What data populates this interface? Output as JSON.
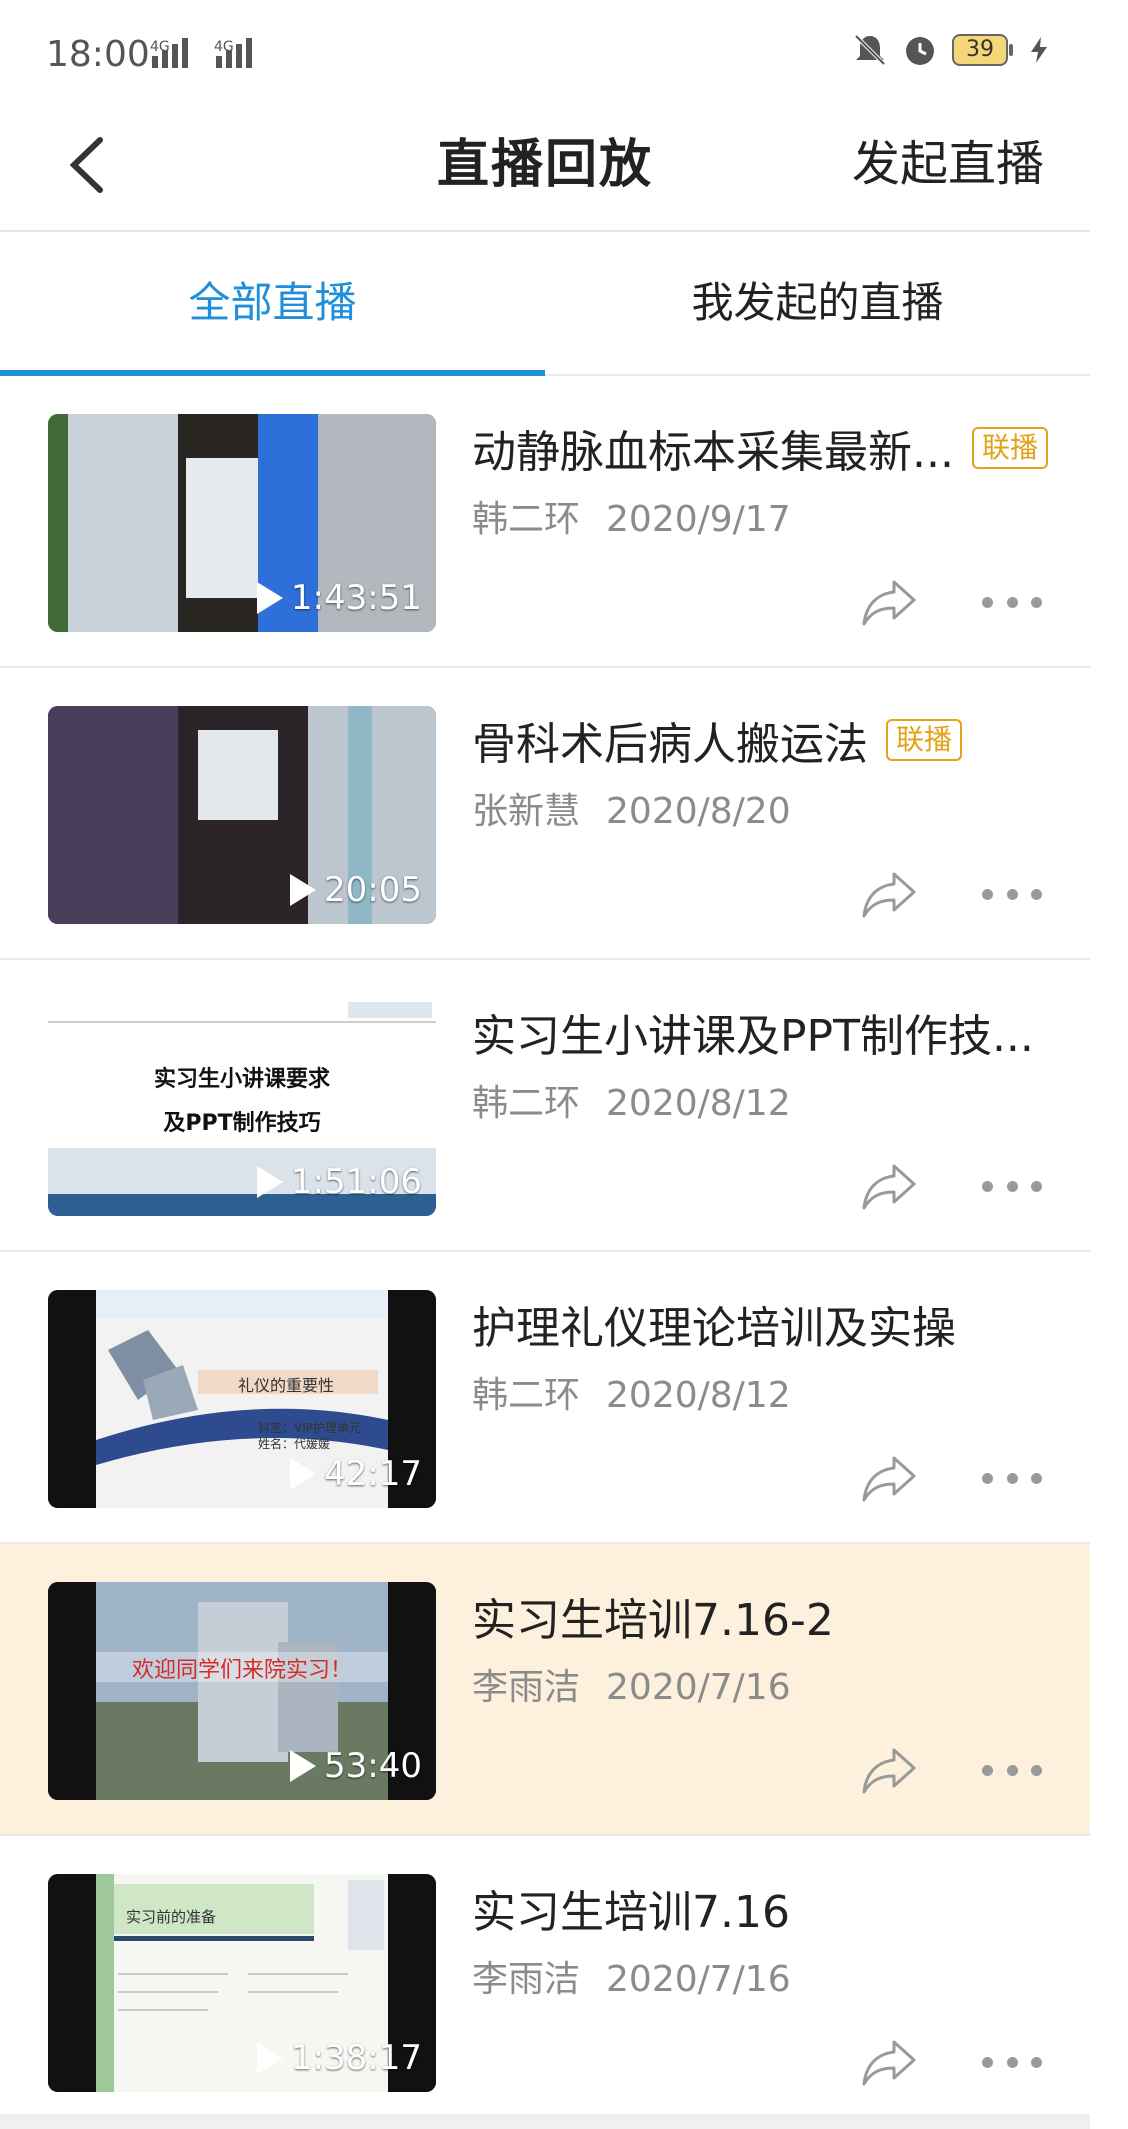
{
  "status_bar": {
    "time": "18:00",
    "net1": "4G",
    "net2": "4G",
    "battery": "39"
  },
  "header": {
    "title": "直播回放",
    "action": "发起直播"
  },
  "tabs": [
    {
      "label": "全部直播",
      "active": true
    },
    {
      "label": "我发起的直播",
      "active": false
    }
  ],
  "items": [
    {
      "title": "动静脉血标本采集最新...",
      "badge": "联播",
      "author": "韩二环",
      "date": "2020/9/17",
      "duration": "1:43:51",
      "thumb": "room-screen"
    },
    {
      "title": "骨科术后病人搬运法",
      "badge": "联播",
      "author": "张新慧",
      "date": "2020/8/20",
      "duration": "20:05",
      "thumb": "room-screen-2"
    },
    {
      "title": "实习生小讲课及PPT制作技...",
      "badge": "",
      "author": "韩二环",
      "date": "2020/8/12",
      "duration": "1:51:06",
      "thumb": "slide-title",
      "slide_lines": [
        "实习生小讲课要求",
        "及PPT制作技巧"
      ]
    },
    {
      "title": "护理礼仪理论培训及实操",
      "badge": "",
      "author": "韩二环",
      "date": "2020/8/12",
      "duration": "42:17",
      "thumb": "slide-etiquette",
      "slide_lines": [
        "礼仪的重要性",
        "科室：VIP护理单元",
        "姓名：代媛媛"
      ]
    },
    {
      "title": "实习生培训7.16-2",
      "badge": "",
      "author": "李雨洁",
      "date": "2020/7/16",
      "duration": "53:40",
      "thumb": "building",
      "highlight": true,
      "slide_lines": [
        "欢迎同学们来院实习！"
      ]
    },
    {
      "title": "实习生培训7.16",
      "badge": "",
      "author": "李雨洁",
      "date": "2020/7/16",
      "duration": "1:38:17",
      "thumb": "slide-prep",
      "slide_lines": [
        "实习前的准备"
      ]
    }
  ],
  "colors": {
    "accent": "#1f8fdc",
    "badge": "#e3a21a",
    "highlight_bg": "#fdf1de"
  }
}
